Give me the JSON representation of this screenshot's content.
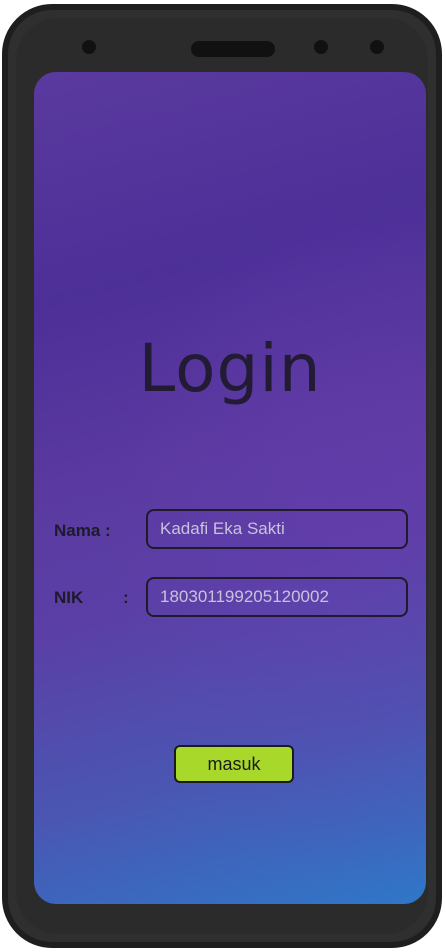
{
  "screen": {
    "title": "Login",
    "fields": [
      {
        "label": "Nama :",
        "value": "Kadafi Eka Sakti"
      },
      {
        "label": "NIK",
        "separator": ":",
        "value": "180301199205120002"
      }
    ],
    "submit_label": "masuk"
  },
  "colors": {
    "button": "#a8d82a",
    "gradient_top": "#5a3a9e",
    "gradient_bottom": "#2f77c8",
    "phone_frame": "#2f2f2f"
  }
}
